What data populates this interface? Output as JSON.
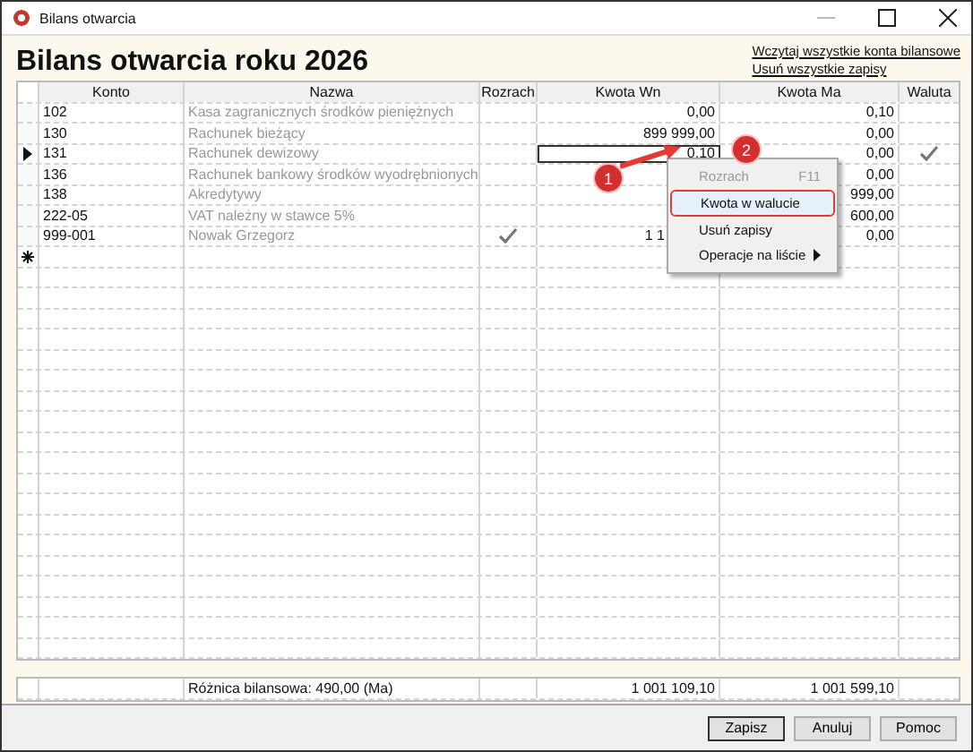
{
  "window": {
    "title": "Bilans otwarcia"
  },
  "heading": "Bilans otwarcia roku 2026",
  "links": [
    "Wczytaj wszystkie konta bilansowe",
    "Usuń wszystkie zapisy"
  ],
  "table": {
    "columns": [
      "Konto",
      "Nazwa",
      "Rozrach",
      "Kwota Wn",
      "Kwota Ma",
      "Waluta"
    ],
    "rows": [
      {
        "konto": "102",
        "nazwa": "Kasa zagranicznych środków pieniężnych",
        "rozrach": false,
        "wn": "0,00",
        "ma": "0,10",
        "waluta": false,
        "selected": false
      },
      {
        "konto": "130",
        "nazwa": "Rachunek bieżący",
        "rozrach": false,
        "wn": "899 999,00",
        "ma": "0,00",
        "waluta": false,
        "selected": false
      },
      {
        "konto": "131",
        "nazwa": "Rachunek dewizowy",
        "rozrach": false,
        "wn": "0,10",
        "ma": "0,00",
        "waluta": true,
        "selected": true
      },
      {
        "konto": "136",
        "nazwa": "Rachunek bankowy środków wyodrębnionych",
        "rozrach": false,
        "ma": "0,00",
        "waluta": false,
        "selected": false
      },
      {
        "konto": "138",
        "nazwa": "Akredytywy",
        "rozrach": false,
        "ma": "999,00",
        "waluta": false,
        "selected": false
      },
      {
        "konto": "222-05",
        "nazwa": "VAT należny w stawce 5%",
        "rozrach": false,
        "ma": "600,00",
        "waluta": false,
        "selected": false
      },
      {
        "konto": "999-001",
        "nazwa": "Nowak Grzegorz",
        "rozrach": true,
        "wn": "1 1",
        "ma": "0,00",
        "waluta": false,
        "selected": false
      }
    ],
    "totals": {
      "label": "Różnica bilansowa: 490,00 (Ma)",
      "wn": "1 001 109,10",
      "ma": "1 001 599,10"
    }
  },
  "context_menu": [
    {
      "label": "Rozrach",
      "shortcut": "F11",
      "disabled": true,
      "highlighted": false,
      "submenu": false
    },
    {
      "label": "Kwota w walucie",
      "disabled": false,
      "highlighted": true,
      "submenu": false
    },
    {
      "label": "Usuń zapisy",
      "disabled": false,
      "highlighted": false,
      "submenu": false
    },
    {
      "label": "Operacje na liście",
      "disabled": false,
      "highlighted": false,
      "submenu": true
    }
  ],
  "callouts": [
    "1",
    "2"
  ],
  "buttons": [
    {
      "label": "Zapisz",
      "default": true
    },
    {
      "label": "Anuluj",
      "default": false
    },
    {
      "label": "Pomoc",
      "default": false
    }
  ]
}
